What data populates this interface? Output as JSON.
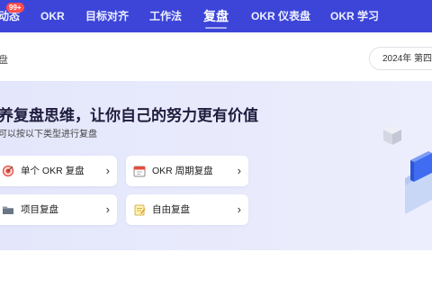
{
  "nav": {
    "items": [
      {
        "label": "动态",
        "badge": "99+"
      },
      {
        "label": "OKR"
      },
      {
        "label": "目标对齐"
      },
      {
        "label": "工作法"
      },
      {
        "label": "复盘"
      },
      {
        "label": "OKR 仪表盘"
      },
      {
        "label": "OKR 学习"
      }
    ],
    "active": "复盘",
    "colors": {
      "background": "#3c45d8",
      "badge": "#ff4d4f"
    }
  },
  "breadcrumb": "盘",
  "period_selector": {
    "value": "2024年 第四"
  },
  "hero": {
    "title": "养复盘思维，让你自己的努力更有价值",
    "subtitle": "可以按以下类型进行复盘",
    "cards": [
      {
        "label": "单个 OKR 复盘",
        "icon": "target-icon"
      },
      {
        "label": "OKR 周期复盘",
        "icon": "calendar-icon"
      },
      {
        "label": "项目复盘",
        "icon": "folder-icon"
      },
      {
        "label": "自由复盘",
        "icon": "notepad-icon"
      }
    ]
  }
}
